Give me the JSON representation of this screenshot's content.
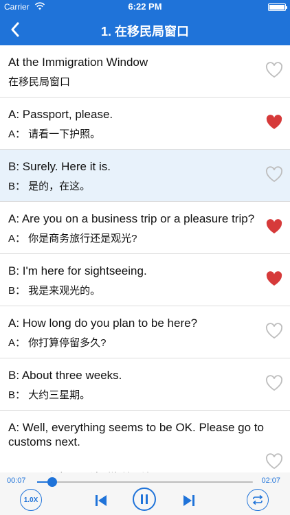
{
  "status_bar": {
    "carrier": "Carrier",
    "time": "6:22 PM"
  },
  "nav": {
    "title": "1. 在移民局窗口",
    "back_icon": "chevron-left-icon"
  },
  "colors": {
    "accent": "#1f73d9",
    "heart_filled": "#d63a3a",
    "heart_outline": "#bdbdbd",
    "highlight_row": "#e8f2fb"
  },
  "rows": [
    {
      "en": "At the Immigration Window",
      "zh": "在移民局窗口",
      "favorite": false
    },
    {
      "en": "A: Passport, please.",
      "zh": "A： 请看一下护照。",
      "favorite": true
    },
    {
      "en": "B: Surely. Here it is.",
      "zh": "B： 是的，在这。",
      "favorite": false
    },
    {
      "en": "A: Are you on a business trip or a pleasure trip?",
      "zh": "A： 你是商务旅行还是观光?",
      "favorite": true
    },
    {
      "en": "B: I'm here for sightseeing.",
      "zh": "B： 我是来观光的。",
      "favorite": true
    },
    {
      "en": "A: How long do you plan to be here?",
      "zh": "A： 你打算停留多久?",
      "favorite": false
    },
    {
      "en": "B: About three weeks.",
      "zh": "B： 大约三星期。",
      "favorite": false
    },
    {
      "en": "A: Well, everything seems to be OK. Please go to customs next.",
      "zh": "A： 嗯，都好了。请到海关那边。",
      "favorite": false
    }
  ],
  "player": {
    "current_time": "00:07",
    "total_time": "02:07",
    "progress": 0.07,
    "speed_label": "1.0X"
  }
}
